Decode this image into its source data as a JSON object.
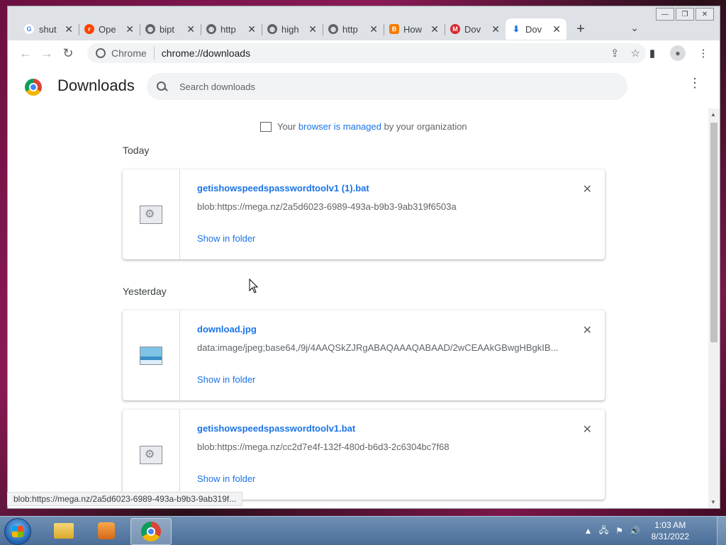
{
  "window": {
    "tabs": [
      {
        "title": "shut",
        "favicon": "google-icon",
        "color": "#4285f4",
        "glyph": "G"
      },
      {
        "title": "Ope",
        "favicon": "reddit-icon",
        "color": "#ff4500",
        "glyph": "r"
      },
      {
        "title": "bipt",
        "favicon": "globe-icon",
        "color": "#5f6368",
        "glyph": "◍"
      },
      {
        "title": "http",
        "favicon": "globe-icon",
        "color": "#5f6368",
        "glyph": "◍"
      },
      {
        "title": "high",
        "favicon": "globe-icon",
        "color": "#5f6368",
        "glyph": "◍"
      },
      {
        "title": "http",
        "favicon": "globe-icon",
        "color": "#5f6368",
        "glyph": "◍"
      },
      {
        "title": "How",
        "favicon": "blogger-icon",
        "color": "#f57c00",
        "glyph": "B"
      },
      {
        "title": "Dov",
        "favicon": "mega-icon",
        "color": "#d9272e",
        "glyph": "M"
      },
      {
        "title": "Dov",
        "favicon": "download-icon",
        "color": "#1a73e8",
        "glyph": "⬇",
        "active": true
      }
    ]
  },
  "toolbar": {
    "omnibox_label": "Chrome",
    "url": "chrome://downloads"
  },
  "page": {
    "title": "Downloads",
    "search_placeholder": "Search downloads",
    "managed": {
      "before": "Your",
      "link": "browser is managed",
      "after": "by your organization"
    },
    "groups": [
      {
        "date": "Today",
        "items": [
          {
            "name": "getishowspeedspasswordtoolv1 (1).bat",
            "url": "blob:https://mega.nz/2a5d6023-6989-493a-b9b3-9ab319f6503a",
            "action": "Show in folder",
            "type": "bat"
          }
        ]
      },
      {
        "date": "Yesterday",
        "items": [
          {
            "name": "download.jpg",
            "url": "data:image/jpeg;base64,/9j/4AAQSkZJRgABAQAAAQABAAD/2wCEAAkGBwgHBgkIB...",
            "action": "Show in folder",
            "type": "jpg"
          },
          {
            "name": "getishowspeedspasswordtoolv1.bat",
            "url": "blob:https://mega.nz/cc2d7e4f-132f-480d-b6d3-2c6304bc7f68",
            "action": "Show in folder",
            "type": "bat"
          }
        ]
      }
    ]
  },
  "status_bar": "blob:https://mega.nz/2a5d6023-6989-493a-b9b3-9ab319f...",
  "taskbar": {
    "time": "1:03 AM",
    "date": "8/31/2022"
  }
}
